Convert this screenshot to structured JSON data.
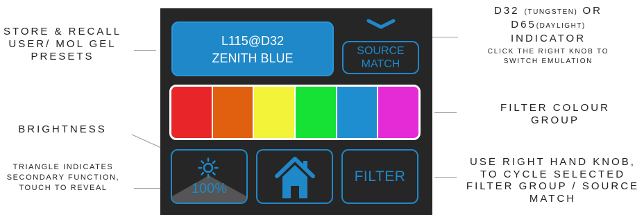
{
  "annotations": {
    "presets": "STORE & RECALL USER/ MOL GEL PRESETS",
    "brightness": "BRIGHTNESS",
    "triangle": "TRIANGLE INDICATES SECONDARY FUNCTION, TOUCH TO REVEAL",
    "indicator_d32": "D32",
    "indicator_tungsten": "(TUNGSTEN)",
    "indicator_or": "OR",
    "indicator_d65": "D65",
    "indicator_daylight": "(DAYLIGHT)",
    "indicator_word": "INDICATOR",
    "indicator_hint": "CLICK THE RIGHT KNOB TO SWITCH EMULATION",
    "filter_group": "FILTER COLOUR GROUP",
    "knob": "USE RIGHT HAND KNOB, TO CYCLE SELECTED FILTER GROUP / SOURCE MATCH"
  },
  "screen": {
    "preset_line1": "L115@D32",
    "preset_line2": "ZENITH BLUE",
    "source_match_line1": "SOURCE",
    "source_match_line2": "MATCH",
    "brightness_value": "100%",
    "filter_label": "FILTER",
    "accent_color": "#1f88c9",
    "swatch_colors": [
      "#e8262a",
      "#e0600f",
      "#f3f339",
      "#16e236",
      "#1f8ed0",
      "#e52bd6"
    ],
    "icons": [
      "chevron-down-icon",
      "sun-icon",
      "home-icon"
    ]
  }
}
